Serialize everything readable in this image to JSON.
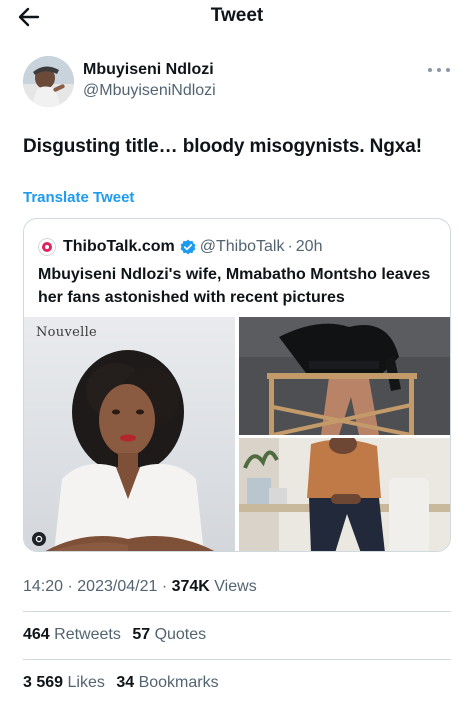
{
  "header": {
    "title": "Tweet",
    "back_icon": "back-arrow-icon"
  },
  "author": {
    "name": "Mbuyiseni Ndlozi",
    "handle": "@MbuyiseniNdlozi"
  },
  "tweet": {
    "text": "Disgusting title… bloody misogynists. Ngxa!",
    "translate_label": "Translate Tweet"
  },
  "quote": {
    "name": "ThiboTalk.com",
    "handle": "@ThiboTalk",
    "separator": "·",
    "time": "20h",
    "text": "Mbuyiseni Ndlozi's wife, Mmabatho Montsho leaves her fans astonished with recent pictures",
    "magazine_label": "Nouvelle",
    "colors": {
      "verified": "#1d9bf0",
      "logo": "#e0245e"
    }
  },
  "meta": {
    "time": "14:20",
    "sep1": "·",
    "date": "2023/04/21",
    "sep2": "·",
    "views_count": "374K",
    "views_label": "Views"
  },
  "stats_row1": {
    "retweets_count": "464",
    "retweets_label": "Retweets",
    "quotes_count": "57",
    "quotes_label": "Quotes"
  },
  "stats_row2": {
    "likes_count": "3 569",
    "likes_label": "Likes",
    "bookmarks_count": "34",
    "bookmarks_label": "Bookmarks"
  },
  "colors": {
    "accent": "#1d9bf0",
    "text": "#0f1419",
    "secondary": "#536471",
    "border": "#cfd9de"
  }
}
